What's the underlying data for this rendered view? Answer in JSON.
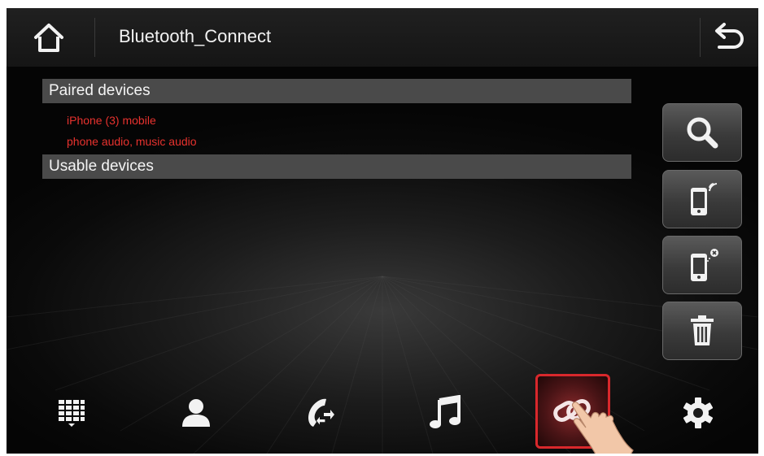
{
  "header": {
    "title": "Bluetooth_Connect"
  },
  "paired": {
    "label": "Paired devices",
    "device_name": "iPhone (3) mobile",
    "device_profiles": "phone audio, music audio"
  },
  "usable": {
    "label": "Usable devices"
  },
  "side_buttons": [
    "search-icon",
    "connect-phone-icon",
    "disconnect-phone-icon",
    "trash-icon"
  ],
  "bottom_nav": [
    "dialpad-icon",
    "contacts-icon",
    "call-log-icon",
    "music-icon",
    "link-icon",
    "settings-icon"
  ],
  "bottom_nav_active": "link-icon",
  "colors": {
    "device_text": "#e8322e",
    "active_border": "#d9282c",
    "section_bar": "#4a4a4a"
  }
}
